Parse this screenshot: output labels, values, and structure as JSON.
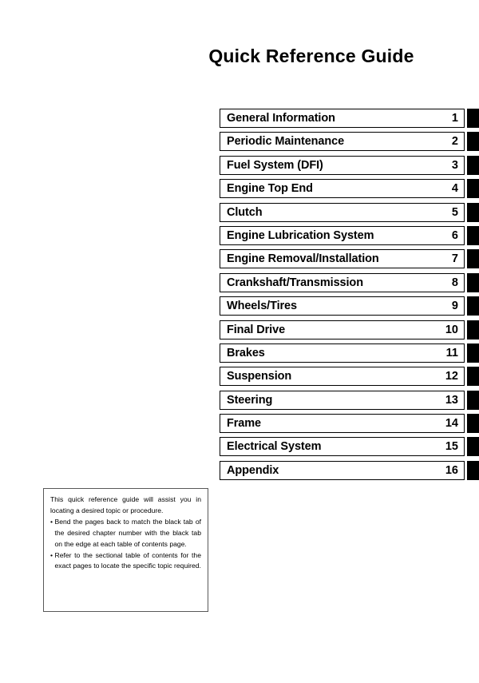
{
  "document": {
    "title": "Quick Reference Guide",
    "page_background": "#ffffff",
    "text_color": "#000000",
    "tab_color": "#000000"
  },
  "chapter_index": {
    "rows": [
      {
        "name": "General Information",
        "number": "1"
      },
      {
        "name": "Periodic Maintenance",
        "number": "2"
      },
      {
        "name": "Fuel System (DFI)",
        "number": "3"
      },
      {
        "name": "Engine Top End",
        "number": "4"
      },
      {
        "name": "Clutch",
        "number": "5"
      },
      {
        "name": "Engine Lubrication System",
        "number": "6"
      },
      {
        "name": "Engine Removal/Installation",
        "number": "7"
      },
      {
        "name": "Crankshaft/Transmission",
        "number": "8"
      },
      {
        "name": "Wheels/Tires",
        "number": "9"
      },
      {
        "name": "Final Drive",
        "number": "10"
      },
      {
        "name": "Brakes",
        "number": "11"
      },
      {
        "name": "Suspension",
        "number": "12"
      },
      {
        "name": "Steering",
        "number": "13"
      },
      {
        "name": "Frame",
        "number": "14"
      },
      {
        "name": "Electrical System",
        "number": "15"
      },
      {
        "name": "Appendix",
        "number": "16"
      }
    ]
  },
  "note": {
    "intro": "This quick reference guide will assist you in locating a desired topic or procedure.",
    "bullet_glyph": "•",
    "bullets": [
      "Bend the pages back to match the black tab of the desired chapter number with the black tab on the edge at each table of contents page.",
      "Refer to the sectional table of contents for the exact pages to locate the specific topic required."
    ]
  }
}
